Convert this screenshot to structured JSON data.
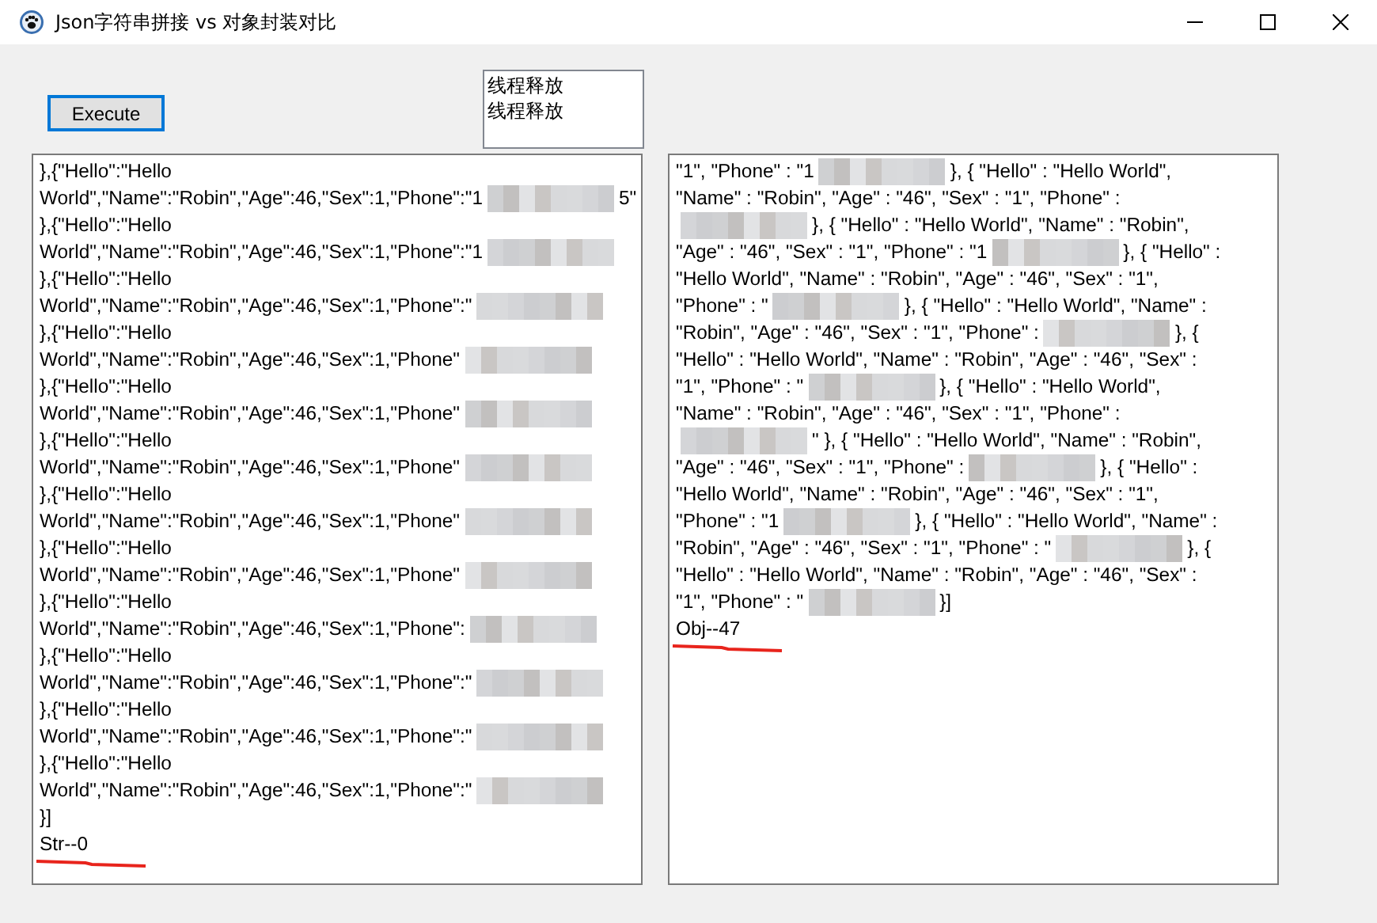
{
  "window": {
    "title": "Json字符串拼接 vs 对象封装对比"
  },
  "execute_button": {
    "label": "Execute",
    "focused": true
  },
  "log_list": {
    "items": [
      "线程释放",
      "线程释放"
    ]
  },
  "panels": [
    {
      "lines": [
        [
          {
            "kind": "text",
            "text": "},{\"Hello\":\"Hello"
          }
        ],
        [
          {
            "kind": "text",
            "text": "World\",\"Name\":\"Robin\",\"Age\":46,\"Sex\":1,\"Phone\":\"1"
          },
          {
            "kind": "blur"
          },
          {
            "kind": "text",
            "text": "5\""
          }
        ],
        [
          {
            "kind": "text",
            "text": "},{\"Hello\":\"Hello"
          }
        ],
        [
          {
            "kind": "text",
            "text": "World\",\"Name\":\"Robin\",\"Age\":46,\"Sex\":1,\"Phone\":\"1"
          },
          {
            "kind": "blur"
          }
        ],
        [
          {
            "kind": "text",
            "text": "},{\"Hello\":\"Hello"
          }
        ],
        [
          {
            "kind": "text",
            "text": "World\",\"Name\":\"Robin\",\"Age\":46,\"Sex\":1,\"Phone\":\""
          },
          {
            "kind": "blur"
          }
        ],
        [
          {
            "kind": "text",
            "text": "},{\"Hello\":\"Hello"
          }
        ],
        [
          {
            "kind": "text",
            "text": "World\",\"Name\":\"Robin\",\"Age\":46,\"Sex\":1,\"Phone\""
          },
          {
            "kind": "blur"
          }
        ],
        [
          {
            "kind": "text",
            "text": "},{\"Hello\":\"Hello"
          }
        ],
        [
          {
            "kind": "text",
            "text": "World\",\"Name\":\"Robin\",\"Age\":46,\"Sex\":1,\"Phone\""
          },
          {
            "kind": "blur"
          }
        ],
        [
          {
            "kind": "text",
            "text": "},{\"Hello\":\"Hello"
          }
        ],
        [
          {
            "kind": "text",
            "text": "World\",\"Name\":\"Robin\",\"Age\":46,\"Sex\":1,\"Phone\""
          },
          {
            "kind": "blur"
          }
        ],
        [
          {
            "kind": "text",
            "text": "},{\"Hello\":\"Hello"
          }
        ],
        [
          {
            "kind": "text",
            "text": "World\",\"Name\":\"Robin\",\"Age\":46,\"Sex\":1,\"Phone\""
          },
          {
            "kind": "blur"
          }
        ],
        [
          {
            "kind": "text",
            "text": "},{\"Hello\":\"Hello"
          }
        ],
        [
          {
            "kind": "text",
            "text": "World\",\"Name\":\"Robin\",\"Age\":46,\"Sex\":1,\"Phone\""
          },
          {
            "kind": "blur"
          }
        ],
        [
          {
            "kind": "text",
            "text": "},{\"Hello\":\"Hello"
          }
        ],
        [
          {
            "kind": "text",
            "text": "World\",\"Name\":\"Robin\",\"Age\":46,\"Sex\":1,\"Phone\":"
          },
          {
            "kind": "blur"
          }
        ],
        [
          {
            "kind": "text",
            "text": "},{\"Hello\":\"Hello"
          }
        ],
        [
          {
            "kind": "text",
            "text": "World\",\"Name\":\"Robin\",\"Age\":46,\"Sex\":1,\"Phone\":\""
          },
          {
            "kind": "blur"
          }
        ],
        [
          {
            "kind": "text",
            "text": "},{\"Hello\":\"Hello"
          }
        ],
        [
          {
            "kind": "text",
            "text": "World\",\"Name\":\"Robin\",\"Age\":46,\"Sex\":1,\"Phone\":\""
          },
          {
            "kind": "blur"
          }
        ],
        [
          {
            "kind": "text",
            "text": "},{\"Hello\":\"Hello"
          }
        ],
        [
          {
            "kind": "text",
            "text": "World\",\"Name\":\"Robin\",\"Age\":46,\"Sex\":1,\"Phone\":\""
          },
          {
            "kind": "blur"
          }
        ],
        [
          {
            "kind": "text",
            "text": "}]"
          }
        ]
      ],
      "result": "Str--0",
      "underlined": true
    },
    {
      "lines": [
        [
          {
            "kind": "text",
            "text": "\"1\", \"Phone\" : \"1"
          },
          {
            "kind": "blur"
          },
          {
            "kind": "text",
            "text": "}, { \"Hello\" : \"Hello World\","
          }
        ],
        [
          {
            "kind": "text",
            "text": "\"Name\" : \"Robin\", \"Age\" : \"46\", \"Sex\" : \"1\", \"Phone\" :"
          }
        ],
        [
          {
            "kind": "blur"
          },
          {
            "kind": "text",
            "text": "}, { \"Hello\" : \"Hello World\", \"Name\" : \"Robin\","
          }
        ],
        [
          {
            "kind": "text",
            "text": "\"Age\" : \"46\", \"Sex\" : \"1\", \"Phone\" : \"1"
          },
          {
            "kind": "blur"
          },
          {
            "kind": "text",
            "text": "}, { \"Hello\" :"
          }
        ],
        [
          {
            "kind": "text",
            "text": "\"Hello World\", \"Name\" : \"Robin\", \"Age\" : \"46\", \"Sex\" : \"1\","
          }
        ],
        [
          {
            "kind": "text",
            "text": "\"Phone\" : \""
          },
          {
            "kind": "blur"
          },
          {
            "kind": "text",
            "text": "}, { \"Hello\" : \"Hello World\", \"Name\" :"
          }
        ],
        [
          {
            "kind": "text",
            "text": "\"Robin\", \"Age\" : \"46\", \"Sex\" : \"1\", \"Phone\" :"
          },
          {
            "kind": "blur"
          },
          {
            "kind": "text",
            "text": "}, {"
          }
        ],
        [
          {
            "kind": "text",
            "text": "\"Hello\" : \"Hello World\", \"Name\" : \"Robin\", \"Age\" : \"46\", \"Sex\" :"
          }
        ],
        [
          {
            "kind": "text",
            "text": "\"1\", \"Phone\" : \""
          },
          {
            "kind": "blur"
          },
          {
            "kind": "text",
            "text": "}, { \"Hello\" : \"Hello World\","
          }
        ],
        [
          {
            "kind": "text",
            "text": "\"Name\" : \"Robin\", \"Age\" : \"46\", \"Sex\" : \"1\", \"Phone\" :"
          }
        ],
        [
          {
            "kind": "blur"
          },
          {
            "kind": "text",
            "text": "\" }, { \"Hello\" : \"Hello World\", \"Name\" : \"Robin\","
          }
        ],
        [
          {
            "kind": "text",
            "text": "\"Age\" : \"46\", \"Sex\" : \"1\", \"Phone\" :"
          },
          {
            "kind": "blur"
          },
          {
            "kind": "text",
            "text": "}, { \"Hello\" :"
          }
        ],
        [
          {
            "kind": "text",
            "text": "\"Hello World\", \"Name\" : \"Robin\", \"Age\" : \"46\", \"Sex\" : \"1\","
          }
        ],
        [
          {
            "kind": "text",
            "text": "\"Phone\" : \"1"
          },
          {
            "kind": "blur"
          },
          {
            "kind": "text",
            "text": "}, { \"Hello\" : \"Hello World\", \"Name\" :"
          }
        ],
        [
          {
            "kind": "text",
            "text": "\"Robin\", \"Age\" : \"46\", \"Sex\" : \"1\", \"Phone\" : \""
          },
          {
            "kind": "blur"
          },
          {
            "kind": "text",
            "text": "}, {"
          }
        ],
        [
          {
            "kind": "text",
            "text": "\"Hello\" : \"Hello World\", \"Name\" : \"Robin\", \"Age\" : \"46\", \"Sex\" :"
          }
        ],
        [
          {
            "kind": "text",
            "text": "\"1\", \"Phone\" : \""
          },
          {
            "kind": "blur"
          },
          {
            "kind": "text",
            "text": "}]"
          }
        ]
      ],
      "result": "Obj--47",
      "underlined": true
    }
  ]
}
